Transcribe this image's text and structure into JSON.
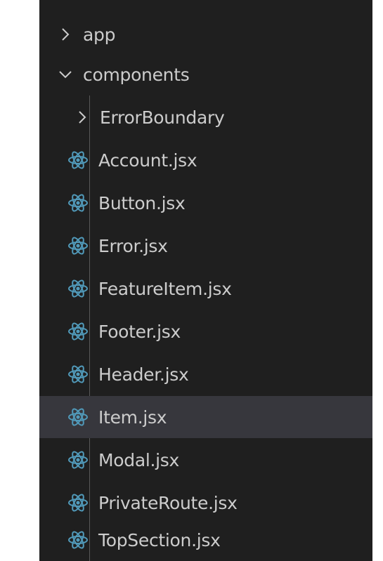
{
  "explorer": {
    "app_folder": {
      "label": "app",
      "expanded": false
    },
    "components_folder": {
      "label": "components",
      "expanded": true
    },
    "errorboundary_folder": {
      "label": "ErrorBoundary",
      "expanded": false
    },
    "files": [
      {
        "label": "Account.jsx",
        "icon": "react-icon",
        "selected": false
      },
      {
        "label": "Button.jsx",
        "icon": "react-icon",
        "selected": false
      },
      {
        "label": "Error.jsx",
        "icon": "react-icon",
        "selected": false
      },
      {
        "label": "FeatureItem.jsx",
        "icon": "react-icon",
        "selected": false
      },
      {
        "label": "Footer.jsx",
        "icon": "react-icon",
        "selected": false
      },
      {
        "label": "Header.jsx",
        "icon": "react-icon",
        "selected": false
      },
      {
        "label": "Item.jsx",
        "icon": "react-icon",
        "selected": true
      },
      {
        "label": "Modal.jsx",
        "icon": "react-icon",
        "selected": false
      },
      {
        "label": "PrivateRoute.jsx",
        "icon": "react-icon",
        "selected": false
      },
      {
        "label": "TopSection.jsx",
        "icon": "react-icon",
        "selected": false
      }
    ]
  },
  "colors": {
    "background": "#1f1f1f",
    "text": "#cccccc",
    "react_icon": "#519aba",
    "selected_row": "#37373d",
    "indent_guide": "#585858"
  }
}
